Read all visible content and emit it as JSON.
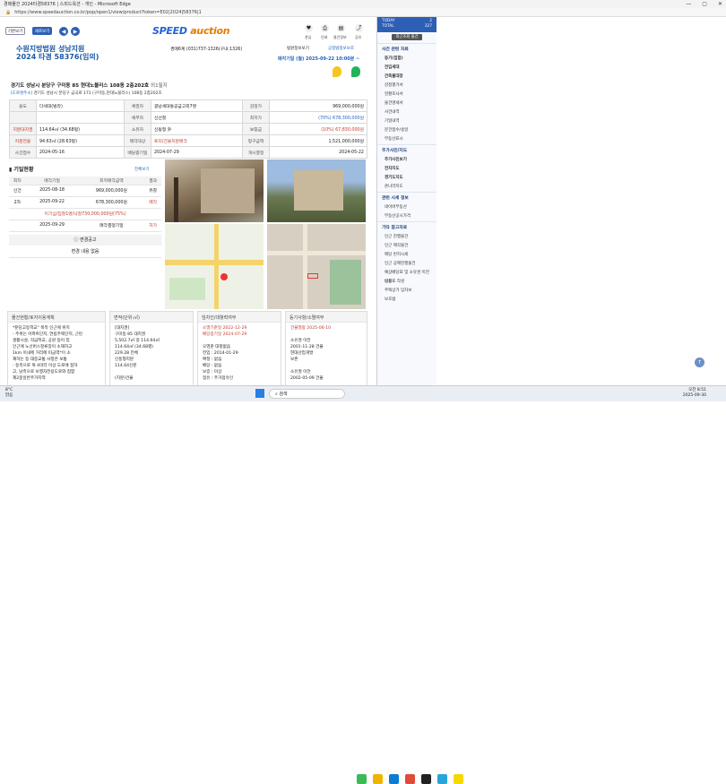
{
  "window": {
    "title": "경매물건 2024타경58376 | 스피드옥션 - 개인 - Microsoft Edge",
    "url": "https://www.speedauction.co.kr/pop/open1/view/product?token=E02|2024|58376|1"
  },
  "top": {
    "btn_print_left": "기본보기",
    "btn_new": "새로보기",
    "logo_a": "SPEED",
    "logo_b": "auction",
    "icons": [
      {
        "name": "heart-icon",
        "glyph": "♥",
        "label": "관심"
      },
      {
        "name": "print-icon",
        "glyph": "⎙",
        "label": "인쇄"
      },
      {
        "name": "doc-icon",
        "glyph": "▤",
        "label": "물건정보"
      },
      {
        "name": "share-icon",
        "glyph": "⤴",
        "label": "공유"
      }
    ],
    "phone": "경매6계 (031)737-1326(구내:1326)",
    "link1": "법원정보보기",
    "link2": "공정법정보보조",
    "sale_date": "매각기일 (월) 2025-09-22 10:00분 ~"
  },
  "court": {
    "name": "수원지방법원 성남지원",
    "case": "2024 타경 58376(임의)"
  },
  "address": {
    "main": "경기도 성남시 분당구 구미동 85 현대노블리스 108동 2층202호",
    "badge": "외1필지",
    "road_tag": "[도로명주소]",
    "road": "경기도 성남시 분당구 금곡로 171 (구미동,현대노블리스) 108동 2층202호"
  },
  "info_rows": [
    [
      "용도",
      "다세대(빌라)",
      "채권자",
      "광남세대통공금고외7명",
      "감정가",
      "969,000,000원"
    ],
    [
      "",
      "",
      "채무자",
      "신선철",
      "최저가",
      "(70%) 678,300,000원"
    ],
    [
      "지분대지권",
      "114.64㎡ (34.68평)",
      "소유자",
      "신동형 外",
      "보증금",
      "(10%) 67,830,000원"
    ],
    [
      "지분전용",
      "94.63㎡ (28.63평)",
      "매각대상",
      "토지/건물지분매각",
      "청구금액",
      "1,521,000,000원"
    ],
    [
      "사건접수",
      "2024-05-16",
      "배당종기일",
      "2024-07-29",
      "개시결정",
      "2024-05-22"
    ]
  ],
  "history": {
    "title": "기일현황",
    "view_all": "전체보기",
    "photos_btn": "사진 더보기",
    "headers": [
      "회차",
      "매각기일",
      "최저매각금액",
      "결과"
    ],
    "rows": [
      [
        "신건",
        "2025-08-18",
        "969,000,000원",
        "유찰"
      ],
      [
        "2차",
        "2025-09-22",
        "678,300,000원",
        "매각"
      ]
    ],
    "note": "이기심/입찰1명/낙찰730,000,000원(75%)",
    "row3": [
      "",
      "2025-09-29",
      "매각결정기일",
      "허가"
    ],
    "notice_title": "변경공고",
    "notice_body": "변경 내용 없음"
  },
  "cards": [
    {
      "title": "물건현황/토지이용계획",
      "lines": [
        "*분당고등학교\" 북측 인근에 위치",
        "- 주위는 아파트단지, 연립주택단지, 근린",
        "생활시설, 각급학교, 공원 등이 있",
        "인근에 노선버스정류장이 소재하고",
        "1km 이내에 거리에 미금역*이 소",
        "재하는 등 대중교통 사정은 보통",
        "- 등측으로 폭 4미터 이상 도로에 접하",
        "고, 남측으로 보행자전용도로와 접함",
        "제2종일반주거지역"
      ]
    },
    {
      "title": "면적(단위:㎡)",
      "lines": [
        "[대지권]",
        "구미동 85 대지권",
        "5,502.7㎡ 중 114.64㎡",
        "114.64㎡ (34.68평)",
        "229.28 전체",
        "신동형지분",
        "114.64신분",
        "",
        "(지분)건물"
      ]
    },
    {
      "title": "임차인/대항력여부",
      "lines": [
        "소멸기준일 2022-12-29",
        "배당종기일 2024-07-29",
        "",
        "오영준 대항없음",
        "전입 : 2014-01-29",
        "확정 : 없음",
        "배당 : 없음",
        "보증 : 미상",
        "점유 : 주거점유인"
      ]
    },
    {
      "title": "등기사항/소멸여부",
      "lines": [
        "건물열람 2025-06-10",
        "",
        "소유권 이전",
        "2001-11-28 건물",
        "현대산업개발",
        "보존",
        "",
        "소유권 이전",
        "2002-05-09 건물"
      ]
    }
  ],
  "sidebar": {
    "today": "TODAY",
    "today_val": "2",
    "total": "TOTAL",
    "total_val": "327",
    "recent": "최근조회 물건",
    "sections": [
      {
        "head": "사건 관련 자료",
        "items": [
          "등기(집합)",
          "전입세대",
          "건축물대장",
          "감정평가서",
          "현황조사서",
          "물건명세서",
          "사건내역",
          "기일내역",
          "문건접수/송달",
          "부동산표시"
        ]
      },
      {
        "head": "추가사진/지도",
        "items": [
          "추가사진보기",
          "전자지도",
          "경기도지도",
          "온나라지도"
        ]
      },
      {
        "head": "관련 시세 정보",
        "items": [
          "네이버부동산",
          "부동산공시가격"
        ]
      },
      {
        "head": "기타 참고자료",
        "items": [
          "인근 진행물건",
          "인근 매각물건",
          "매당 번지시세",
          "인근 공매진행물건",
          "예상배당표 및 소유권 이전비용",
          "입찰표 작성",
          "주택상가 임차보",
          "보호법"
        ]
      }
    ]
  },
  "taskbar": {
    "weather": "8°C",
    "weather2": "맑음",
    "search": "검색",
    "time": "오전 8:51",
    "date": "2025-09-30"
  }
}
